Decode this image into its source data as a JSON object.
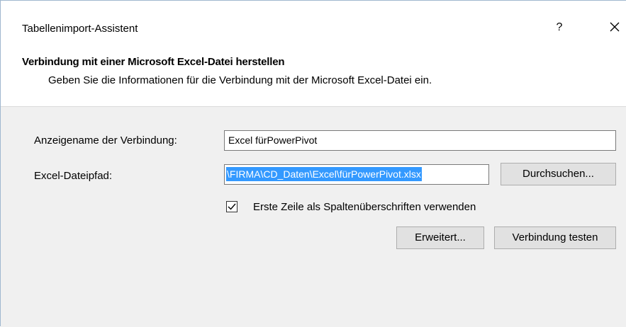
{
  "window": {
    "title": "Tabellenimport-Assistent",
    "help_label": "?",
    "close_icon": "close-icon"
  },
  "header": {
    "title": "Verbindung mit einer Microsoft Excel-Datei herstellen",
    "subtitle": "Geben Sie die Informationen für die Verbindung mit der Microsoft Excel-Datei ein."
  },
  "form": {
    "connection_name_label": "Anzeigename der Verbindung:",
    "connection_name_value": "Excel fürPowerPivot",
    "file_path_label": "Excel-Dateipfad:",
    "file_path_value": "\\FIRMA\\CD_Daten\\Excel\\fürPowerPivot.xlsx",
    "browse_label": "Durchsuchen...",
    "first_row_headers_label": "Erste Zeile als Spaltenüberschriften verwenden",
    "first_row_headers_checked": true,
    "advanced_label": "Erweitert...",
    "test_connection_label": "Verbindung testen"
  },
  "colors": {
    "body_background": "#f0f0f0",
    "selection": "#3399ff",
    "button_face": "#e1e1e1",
    "window_border": "#9fb7cf"
  }
}
